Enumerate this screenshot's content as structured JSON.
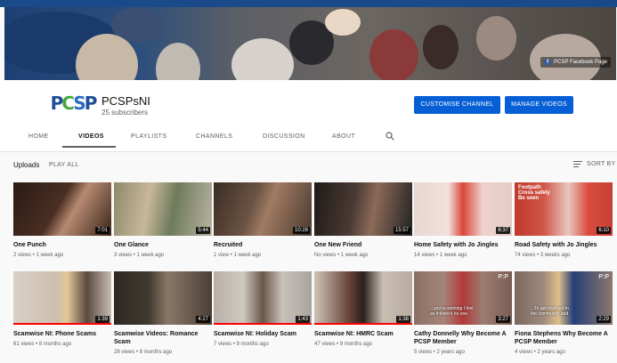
{
  "banner": {
    "badge_label": "PCSP Facebook Page"
  },
  "channel": {
    "name": "PCSPsNI",
    "subscribers": "25 subscribers",
    "avatar_letters": {
      "p1": "P",
      "c": "C",
      "s": "S",
      "p2": "P"
    }
  },
  "actions": {
    "customise": "CUSTOMISE CHANNEL",
    "manage": "MANAGE VIDEOS"
  },
  "tabs": [
    "HOME",
    "VIDEOS",
    "PLAYLISTS",
    "CHANNELS",
    "DISCUSSION",
    "ABOUT"
  ],
  "uploads": {
    "label": "Uploads",
    "play_all": "PLAY ALL",
    "sort_by": "SORT BY"
  },
  "videos": [
    {
      "title": "One Punch",
      "meta": "2 views • 1 week ago",
      "duration": "7:01"
    },
    {
      "title": "One Glance",
      "meta": "3 views • 1 week ago",
      "duration": "5:44"
    },
    {
      "title": "Recruited",
      "meta": "1 view • 1 week ago",
      "duration": "10:28"
    },
    {
      "title": "One New Friend",
      "meta": "No views • 1 week ago",
      "duration": "15:57"
    },
    {
      "title": "Home Safety with Jo Jingles",
      "meta": "14 views • 1 week ago",
      "duration": "6:37"
    },
    {
      "title": "Road Safety with Jo Jingles",
      "meta": "74 views • 3 weeks ago",
      "duration": "6:10",
      "caption": "Footpath\nCross safely\nBe seen"
    },
    {
      "title": "Scamwise NI: Phone Scams",
      "meta": "61 views • 8 months ago",
      "duration": "1:39"
    },
    {
      "title": "Scamwise Videos: Romance Scam",
      "meta": "28 views • 8 months ago",
      "duration": "4:27"
    },
    {
      "title": "Scamwise NI: Holiday Scam",
      "meta": "7 views • 9 months ago",
      "duration": "1:43"
    },
    {
      "title": "Scamwise NI: HMRC Scam",
      "meta": "47 views • 9 months ago",
      "duration": "1:38"
    },
    {
      "title": "Cathy Donnelly Why Become A PCSP Member",
      "meta": "5 views • 2 years ago",
      "duration": "3:27",
      "subtitle": "...you're working I feel\nas if there's no one",
      "mark": "P:P"
    },
    {
      "title": "Fiona Stephens Why Become A PCSP Member",
      "meta": "4 views • 2 years ago",
      "duration": "2:29",
      "subtitle": "...To get involved in\nthe community and",
      "mark": "P:P"
    }
  ],
  "colors": {
    "accent": "#065fd4",
    "banner_top": "#1b4a8a",
    "progress": "#ff0000"
  }
}
